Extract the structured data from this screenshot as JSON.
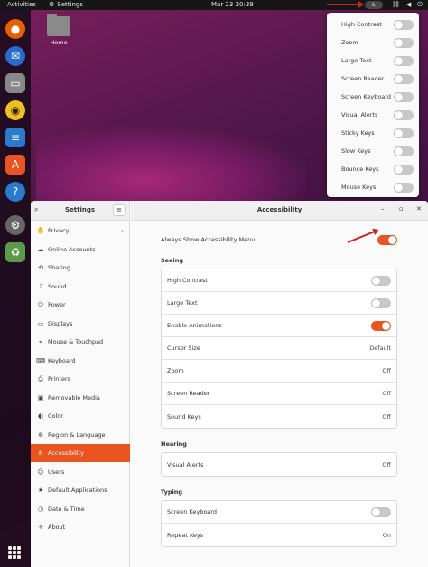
{
  "topbar": {
    "activities": "Activities",
    "app_name": "Settings",
    "clock": "Mar 23  20:39"
  },
  "accessibility_menu": {
    "items": [
      {
        "label": "High Contrast",
        "on": false
      },
      {
        "label": "Zoom",
        "on": false
      },
      {
        "label": "Large Text",
        "on": false
      },
      {
        "label": "Screen Reader",
        "on": false
      },
      {
        "label": "Screen Keyboard",
        "on": false
      },
      {
        "label": "Visual Alerts",
        "on": false
      },
      {
        "label": "Sticky Keys",
        "on": false
      },
      {
        "label": "Slow Keys",
        "on": false
      },
      {
        "label": "Bounce Keys",
        "on": false
      },
      {
        "label": "Mouse Keys",
        "on": false
      }
    ]
  },
  "desktop": {
    "home_label": "Home"
  },
  "dock": {
    "icons": [
      "firefox-icon",
      "thunderbird-icon",
      "files-icon",
      "rhythmbox-icon",
      "writer-icon",
      "software-icon",
      "help-icon",
      "settings-icon",
      "trash-icon"
    ]
  },
  "sidebar": {
    "title": "Settings",
    "items": [
      {
        "label": "Privacy",
        "icon": "hand-icon"
      },
      {
        "label": "Online Accounts",
        "icon": "cloud-icon"
      },
      {
        "label": "Sharing",
        "icon": "share-icon"
      },
      {
        "label": "Sound",
        "icon": "music-icon"
      },
      {
        "label": "Power",
        "icon": "power-icon"
      },
      {
        "label": "Displays",
        "icon": "display-icon"
      },
      {
        "label": "Mouse & Touchpad",
        "icon": "mouse-icon"
      },
      {
        "label": "Keyboard",
        "icon": "keyboard-icon"
      },
      {
        "label": "Printers",
        "icon": "printer-icon"
      },
      {
        "label": "Removable Media",
        "icon": "media-icon"
      },
      {
        "label": "Color",
        "icon": "color-icon"
      },
      {
        "label": "Region & Language",
        "icon": "globe-icon"
      },
      {
        "label": "Accessibility",
        "icon": "accessibility-icon"
      },
      {
        "label": "Users",
        "icon": "users-icon"
      },
      {
        "label": "Default Applications",
        "icon": "star-icon"
      },
      {
        "label": "Date & Time",
        "icon": "clock-icon"
      },
      {
        "label": "About",
        "icon": "info-icon"
      }
    ],
    "active_index": 12
  },
  "main": {
    "title": "Accessibility",
    "always_show_label": "Always Show Accessibility Menu",
    "always_show_on": true,
    "sections": {
      "seeing": {
        "title": "Seeing",
        "rows": [
          {
            "label": "High Contrast",
            "type": "toggle",
            "on": false
          },
          {
            "label": "Large Text",
            "type": "toggle",
            "on": false
          },
          {
            "label": "Enable Animations",
            "type": "toggle",
            "on": true
          },
          {
            "label": "Cursor Size",
            "type": "value",
            "value": "Default"
          },
          {
            "label": "Zoom",
            "type": "value",
            "value": "Off"
          },
          {
            "label": "Screen Reader",
            "type": "value",
            "value": "Off"
          },
          {
            "label": "Sound Keys",
            "type": "value",
            "value": "Off"
          }
        ]
      },
      "hearing": {
        "title": "Hearing",
        "rows": [
          {
            "label": "Visual Alerts",
            "type": "value",
            "value": "Off"
          }
        ]
      },
      "typing": {
        "title": "Typing",
        "rows": [
          {
            "label": "Screen Keyboard",
            "type": "toggle",
            "on": false
          },
          {
            "label": "Repeat Keys",
            "type": "value",
            "value": "On"
          }
        ]
      }
    }
  },
  "colors": {
    "accent": "#e95420"
  }
}
